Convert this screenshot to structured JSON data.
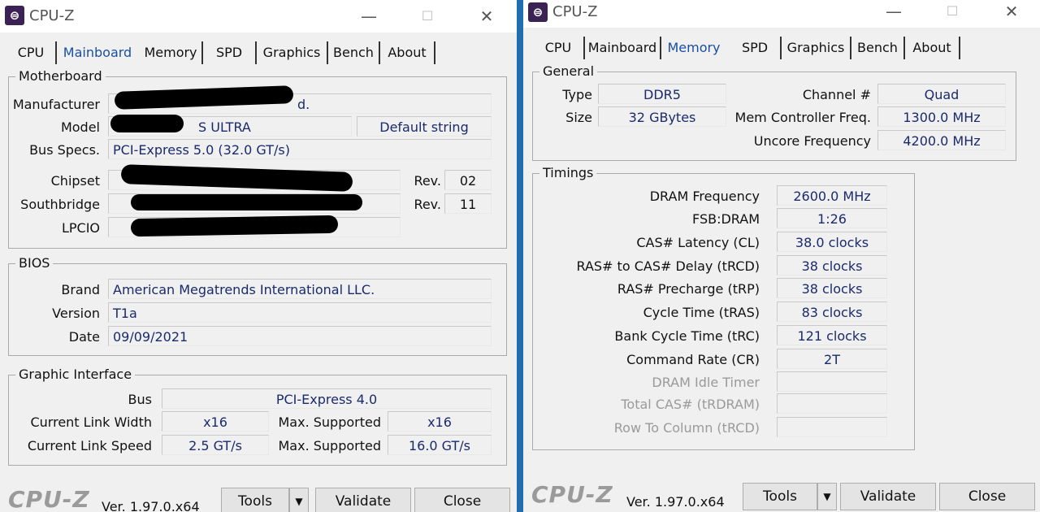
{
  "window_title": "CPU-Z",
  "icons": {
    "app": "cpu-z-logo-icon",
    "minimize": "minimize-icon",
    "maximize": "maximize-icon",
    "close": "close-icon",
    "dropdown": "chevron-down-icon"
  },
  "glyphs": {
    "app": "⊜",
    "minimize": "—",
    "maximize": "☐",
    "close": "✕",
    "dropdown": "▼"
  },
  "tabs": [
    "CPU",
    "Mainboard",
    "Memory",
    "SPD",
    "Graphics",
    "Bench",
    "About"
  ],
  "left": {
    "active_tab": "Mainboard",
    "motherboard": {
      "legend": "Motherboard",
      "manufacturer_label": "Manufacturer",
      "manufacturer_value": "d.",
      "model_label": "Model",
      "model_value": "S ULTRA",
      "model_extra": "Default string",
      "bus_label": "Bus Specs.",
      "bus_value": "PCI-Express 5.0 (32.0 GT/s)",
      "chipset_label": "Chipset",
      "southbridge_label": "Southbridge",
      "lpcio_label": "LPCIO",
      "rev_label": "Rev.",
      "chipset_rev": "02",
      "southbridge_rev": "11"
    },
    "bios": {
      "legend": "BIOS",
      "brand_label": "Brand",
      "brand_value": "American Megatrends International LLC.",
      "version_label": "Version",
      "version_value": "T1a",
      "date_label": "Date",
      "date_value": "09/09/2021"
    },
    "graphic": {
      "legend": "Graphic Interface",
      "bus_label": "Bus",
      "bus_value": "PCI-Express 4.0",
      "width_label": "Current Link Width",
      "width_value": "x16",
      "speed_label": "Current Link Speed",
      "speed_value": "2.5 GT/s",
      "max_label": "Max. Supported",
      "max_width": "x16",
      "max_speed": "16.0 GT/s"
    }
  },
  "right": {
    "active_tab": "Memory",
    "general": {
      "legend": "General",
      "type_label": "Type",
      "type_value": "DDR5",
      "size_label": "Size",
      "size_value": "32 GBytes",
      "channel_label": "Channel #",
      "channel_value": "Quad",
      "memctrl_label": "Mem Controller Freq.",
      "memctrl_value": "1300.0 MHz",
      "uncore_label": "Uncore Frequency",
      "uncore_value": "4200.0 MHz"
    },
    "timings": {
      "legend": "Timings",
      "rows": [
        {
          "label": "DRAM Frequency",
          "value": "2600.0 MHz"
        },
        {
          "label": "FSB:DRAM",
          "value": "1:26"
        },
        {
          "label": "CAS# Latency (CL)",
          "value": "38.0 clocks"
        },
        {
          "label": "RAS# to CAS# Delay (tRCD)",
          "value": "38 clocks"
        },
        {
          "label": "RAS# Precharge (tRP)",
          "value": "38 clocks"
        },
        {
          "label": "Cycle Time (tRAS)",
          "value": "83 clocks"
        },
        {
          "label": "Bank Cycle Time (tRC)",
          "value": "121 clocks"
        },
        {
          "label": "Command Rate (CR)",
          "value": "2T"
        },
        {
          "label": "DRAM Idle Timer",
          "value": ""
        },
        {
          "label": "Total CAS# (tRDRAM)",
          "value": ""
        },
        {
          "label": "Row To Column (tRCD)",
          "value": ""
        }
      ]
    }
  },
  "footer": {
    "brand": "CPU-Z",
    "version": "Ver. 1.97.0.x64",
    "tools": "Tools",
    "validate": "Validate",
    "close": "Close"
  }
}
